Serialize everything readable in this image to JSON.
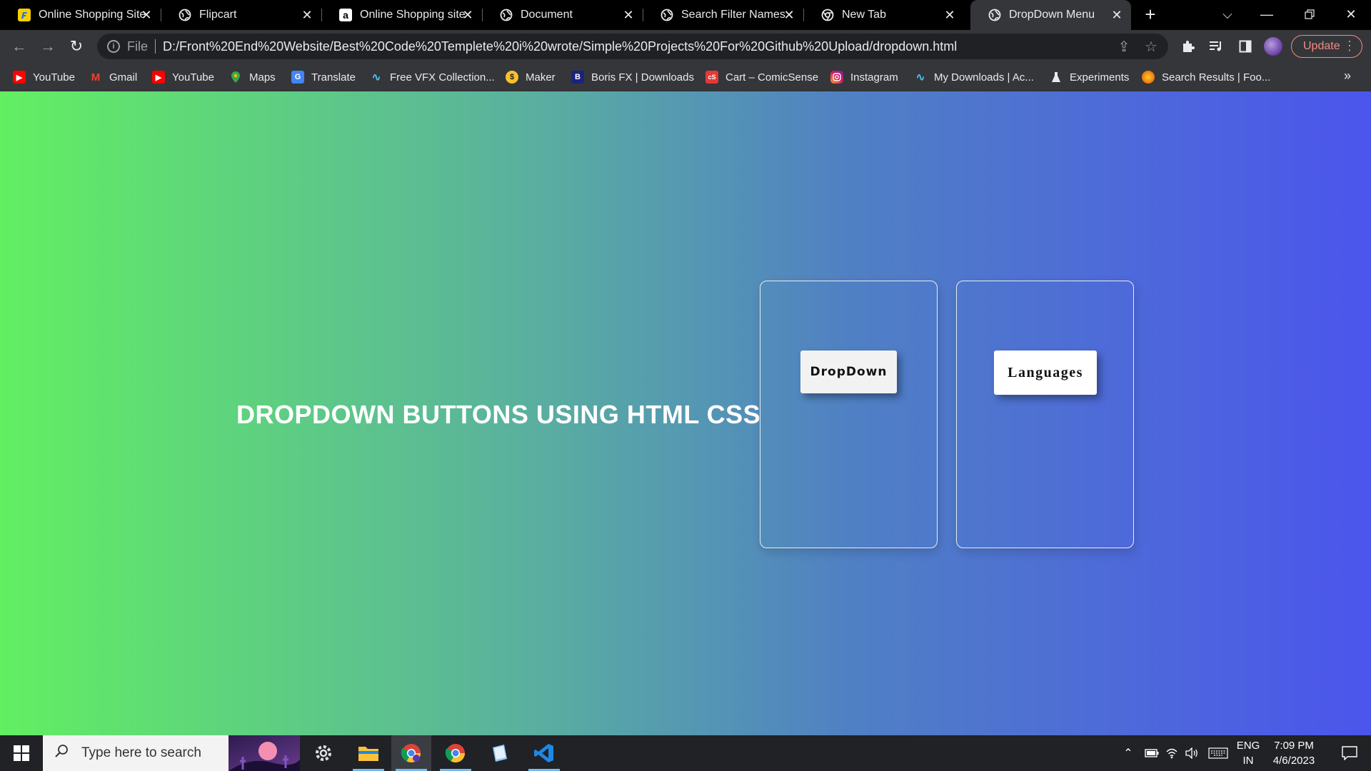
{
  "browser": {
    "tabs": [
      {
        "title": "Online Shopping Site",
        "icon": "flipkart-icon",
        "active": false
      },
      {
        "title": "Flipcart",
        "icon": "globe-icon",
        "active": false
      },
      {
        "title": "Online Shopping site",
        "icon": "amazon-icon",
        "active": false
      },
      {
        "title": "Document",
        "icon": "globe-icon",
        "active": false
      },
      {
        "title": "Search Filter Names",
        "icon": "globe-icon",
        "active": false
      },
      {
        "title": "New Tab",
        "icon": "chrome-icon",
        "active": false
      },
      {
        "title": "DropDown Menu",
        "icon": "globe-icon",
        "active": true
      }
    ],
    "address": {
      "scheme_label": "File",
      "url": "D:/Front%20End%20Website/Best%20Code%20Templete%20i%20wrote/Simple%20Projects%20For%20Github%20Upload/dropdown.html"
    },
    "update_label": "Update",
    "bookmarks": [
      {
        "label": "YouTube",
        "icon": "youtube-icon"
      },
      {
        "label": "Gmail",
        "icon": "gmail-icon"
      },
      {
        "label": "YouTube",
        "icon": "youtube-icon"
      },
      {
        "label": "Maps",
        "icon": "maps-icon"
      },
      {
        "label": "Translate",
        "icon": "translate-icon"
      },
      {
        "label": "Free VFX Collection...",
        "icon": "vfx-icon"
      },
      {
        "label": "Maker",
        "icon": "maker-icon"
      },
      {
        "label": "Boris FX | Downloads",
        "icon": "borisfx-icon"
      },
      {
        "label": "Cart – ComicSense",
        "icon": "comicsense-icon"
      },
      {
        "label": "Instagram",
        "icon": "instagram-icon"
      },
      {
        "label": "My Downloads | Ac...",
        "icon": "vfx-icon"
      },
      {
        "label": "Experiments",
        "icon": "flask-icon"
      },
      {
        "label": "Search Results | Foo...",
        "icon": "foo-icon"
      }
    ],
    "more_bookmarks": "»"
  },
  "page": {
    "headline": "DROPDOWN BUTTONS USING HTML CSS",
    "buttons": [
      {
        "label": "DropDown"
      },
      {
        "label": "Languages"
      }
    ],
    "colors": {
      "gradient_start": "#62ef62",
      "gradient_end": "#4b55ec",
      "button_bg": "#ffffff",
      "headline": "#ffffff"
    }
  },
  "taskbar": {
    "search_placeholder": "Type here to search",
    "apps": [
      "settings-icon",
      "file-explorer-icon",
      "chrome-icon",
      "chrome-icon",
      "notepad-icon",
      "vscode-icon"
    ],
    "language": "ENG",
    "region": "IN",
    "time": "7:09 PM",
    "date": "4/6/2023"
  }
}
